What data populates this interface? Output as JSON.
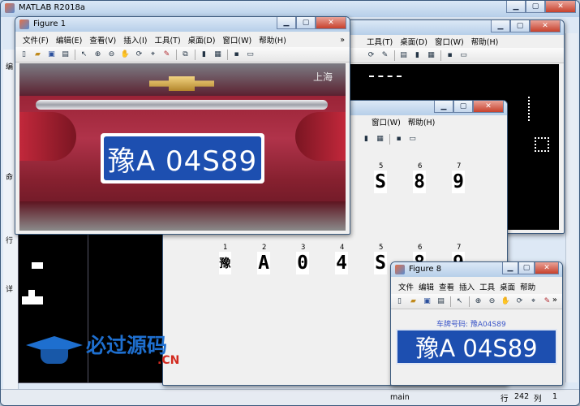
{
  "matlab": {
    "title": "MATLAB R2018a",
    "command_window_label": "main",
    "status": {
      "row_label": "行",
      "row": "242",
      "col_label": "列",
      "col": "1"
    },
    "side_chars": [
      "编",
      "命",
      "行",
      "详"
    ]
  },
  "fig1": {
    "title": "Figure 1",
    "menu": [
      "文件(F)",
      "编辑(E)",
      "查看(V)",
      "插入(I)",
      "工具(T)",
      "桌面(D)",
      "窗口(W)",
      "帮助(H)"
    ],
    "plate_text": "豫A 04S89",
    "sticker_text": "上海",
    "chevron": "»"
  },
  "fig_back": {
    "menu": [
      "工具(T)",
      "桌面(D)",
      "窗口(W)",
      "帮助(H)"
    ]
  },
  "fig_mid": {
    "menu": [
      "窗口(W)",
      "帮助(H)"
    ],
    "chars_top": [
      {
        "num": "5",
        "ch": "S"
      },
      {
        "num": "6",
        "ch": "8"
      },
      {
        "num": "7",
        "ch": "9"
      }
    ]
  },
  "fig_chars": {
    "chars": [
      {
        "num": "1",
        "ch": "豫"
      },
      {
        "num": "2",
        "ch": "A"
      },
      {
        "num": "3",
        "ch": "0"
      },
      {
        "num": "4",
        "ch": "4"
      },
      {
        "num": "5",
        "ch": "S"
      },
      {
        "num": "6",
        "ch": "8"
      },
      {
        "num": "7",
        "ch": "9"
      }
    ]
  },
  "fig8": {
    "title": "Figure 8",
    "menu": [
      "文件",
      "编辑",
      "查看",
      "插入",
      "工具",
      "桌面",
      "帮助"
    ],
    "result_label": "车牌号码:  豫A04S89",
    "plate_text": "豫A 04S89",
    "chevron": "»"
  },
  "watermark": {
    "text": "必过源码",
    "suffix": ".CN"
  },
  "colors": {
    "plate_blue": "#1d4fb0",
    "car_red": "#9b2437",
    "watermark_blue": "#1e6fcf"
  }
}
